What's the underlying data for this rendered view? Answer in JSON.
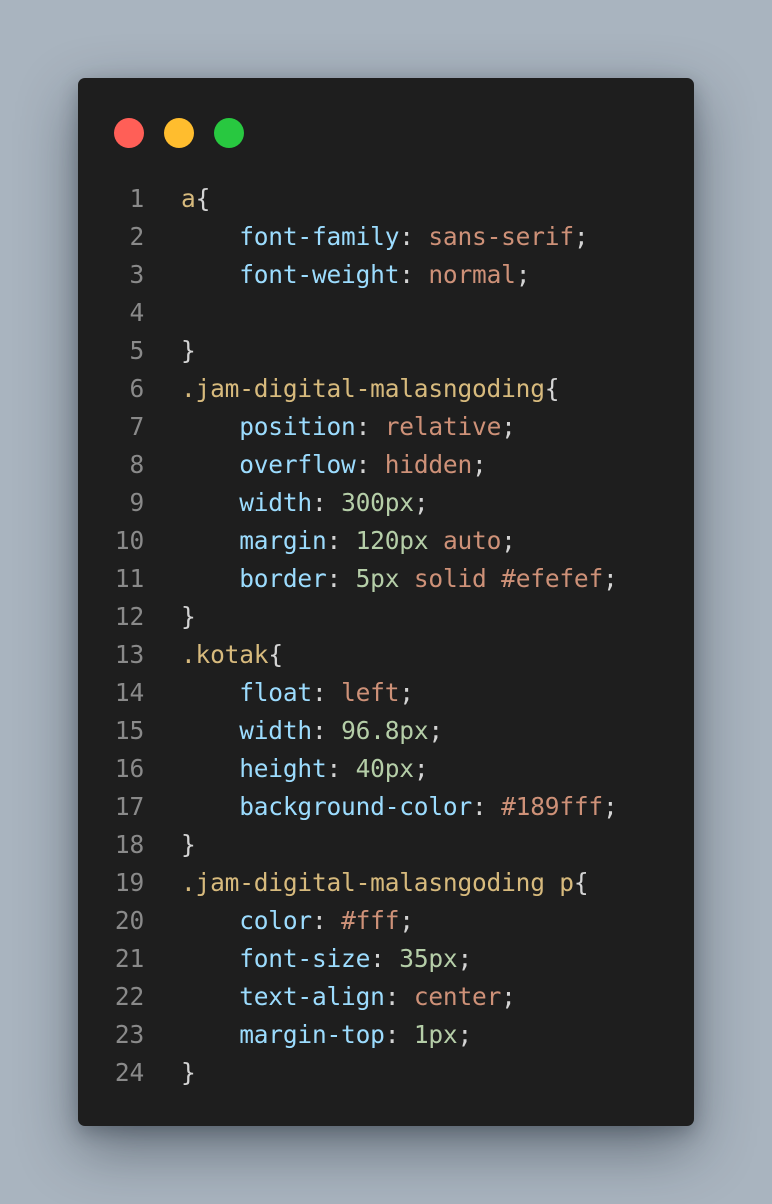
{
  "window": {
    "controls": [
      {
        "name": "close",
        "color": "#ff5f57"
      },
      {
        "name": "minimize",
        "color": "#ffbd2e"
      },
      {
        "name": "maximize",
        "color": "#28c840"
      }
    ]
  },
  "code_lines": [
    {
      "n": "1",
      "tokens": [
        {
          "t": "a",
          "c": "sel"
        },
        {
          "t": "{",
          "c": "punc"
        }
      ]
    },
    {
      "n": "2",
      "tokens": [
        {
          "t": "    ",
          "c": "punc"
        },
        {
          "t": "font-family",
          "c": "prop"
        },
        {
          "t": ": ",
          "c": "punc"
        },
        {
          "t": "sans-serif",
          "c": "val"
        },
        {
          "t": ";",
          "c": "punc"
        }
      ]
    },
    {
      "n": "3",
      "tokens": [
        {
          "t": "    ",
          "c": "punc"
        },
        {
          "t": "font-weight",
          "c": "prop"
        },
        {
          "t": ": ",
          "c": "punc"
        },
        {
          "t": "normal",
          "c": "val"
        },
        {
          "t": ";",
          "c": "punc"
        }
      ]
    },
    {
      "n": "4",
      "tokens": []
    },
    {
      "n": "5",
      "tokens": [
        {
          "t": "}",
          "c": "punc"
        }
      ]
    },
    {
      "n": "6",
      "tokens": [
        {
          "t": ".jam-digital-malasngoding",
          "c": "sel"
        },
        {
          "t": "{",
          "c": "punc"
        }
      ]
    },
    {
      "n": "7",
      "tokens": [
        {
          "t": "    ",
          "c": "punc"
        },
        {
          "t": "position",
          "c": "prop"
        },
        {
          "t": ": ",
          "c": "punc"
        },
        {
          "t": "relative",
          "c": "val"
        },
        {
          "t": ";",
          "c": "punc"
        }
      ]
    },
    {
      "n": "8",
      "tokens": [
        {
          "t": "    ",
          "c": "punc"
        },
        {
          "t": "overflow",
          "c": "prop"
        },
        {
          "t": ": ",
          "c": "punc"
        },
        {
          "t": "hidden",
          "c": "val"
        },
        {
          "t": ";",
          "c": "punc"
        }
      ]
    },
    {
      "n": "9",
      "tokens": [
        {
          "t": "    ",
          "c": "punc"
        },
        {
          "t": "width",
          "c": "prop"
        },
        {
          "t": ": ",
          "c": "punc"
        },
        {
          "t": "300px",
          "c": "num"
        },
        {
          "t": ";",
          "c": "punc"
        }
      ]
    },
    {
      "n": "10",
      "tokens": [
        {
          "t": "    ",
          "c": "punc"
        },
        {
          "t": "margin",
          "c": "prop"
        },
        {
          "t": ": ",
          "c": "punc"
        },
        {
          "t": "120px",
          "c": "num"
        },
        {
          "t": " ",
          "c": "punc"
        },
        {
          "t": "auto",
          "c": "val"
        },
        {
          "t": ";",
          "c": "punc"
        }
      ]
    },
    {
      "n": "11",
      "tokens": [
        {
          "t": "    ",
          "c": "punc"
        },
        {
          "t": "border",
          "c": "prop"
        },
        {
          "t": ": ",
          "c": "punc"
        },
        {
          "t": "5px",
          "c": "num"
        },
        {
          "t": " ",
          "c": "punc"
        },
        {
          "t": "solid",
          "c": "val"
        },
        {
          "t": " ",
          "c": "punc"
        },
        {
          "t": "#efefef",
          "c": "val"
        },
        {
          "t": ";",
          "c": "punc"
        }
      ]
    },
    {
      "n": "12",
      "tokens": [
        {
          "t": "}",
          "c": "punc"
        }
      ]
    },
    {
      "n": "13",
      "tokens": [
        {
          "t": ".kotak",
          "c": "sel"
        },
        {
          "t": "{",
          "c": "punc"
        }
      ]
    },
    {
      "n": "14",
      "tokens": [
        {
          "t": "    ",
          "c": "punc"
        },
        {
          "t": "float",
          "c": "prop"
        },
        {
          "t": ": ",
          "c": "punc"
        },
        {
          "t": "left",
          "c": "val"
        },
        {
          "t": ";",
          "c": "punc"
        }
      ]
    },
    {
      "n": "15",
      "tokens": [
        {
          "t": "    ",
          "c": "punc"
        },
        {
          "t": "width",
          "c": "prop"
        },
        {
          "t": ": ",
          "c": "punc"
        },
        {
          "t": "96.8px",
          "c": "num"
        },
        {
          "t": ";",
          "c": "punc"
        }
      ]
    },
    {
      "n": "16",
      "tokens": [
        {
          "t": "    ",
          "c": "punc"
        },
        {
          "t": "height",
          "c": "prop"
        },
        {
          "t": ": ",
          "c": "punc"
        },
        {
          "t": "40px",
          "c": "num"
        },
        {
          "t": ";",
          "c": "punc"
        }
      ]
    },
    {
      "n": "17",
      "tokens": [
        {
          "t": "    ",
          "c": "punc"
        },
        {
          "t": "background-color",
          "c": "prop"
        },
        {
          "t": ": ",
          "c": "punc"
        },
        {
          "t": "#189fff",
          "c": "val"
        },
        {
          "t": ";",
          "c": "punc"
        }
      ]
    },
    {
      "n": "18",
      "tokens": [
        {
          "t": "}",
          "c": "punc"
        }
      ]
    },
    {
      "n": "19",
      "tokens": [
        {
          "t": ".jam-digital-malasngoding p",
          "c": "sel"
        },
        {
          "t": "{",
          "c": "punc"
        }
      ]
    },
    {
      "n": "20",
      "tokens": [
        {
          "t": "    ",
          "c": "punc"
        },
        {
          "t": "color",
          "c": "prop"
        },
        {
          "t": ": ",
          "c": "punc"
        },
        {
          "t": "#fff",
          "c": "val"
        },
        {
          "t": ";",
          "c": "punc"
        }
      ]
    },
    {
      "n": "21",
      "tokens": [
        {
          "t": "    ",
          "c": "punc"
        },
        {
          "t": "font-size",
          "c": "prop"
        },
        {
          "t": ": ",
          "c": "punc"
        },
        {
          "t": "35px",
          "c": "num"
        },
        {
          "t": ";",
          "c": "punc"
        }
      ]
    },
    {
      "n": "22",
      "tokens": [
        {
          "t": "    ",
          "c": "punc"
        },
        {
          "t": "text-align",
          "c": "prop"
        },
        {
          "t": ": ",
          "c": "punc"
        },
        {
          "t": "center",
          "c": "val"
        },
        {
          "t": ";",
          "c": "punc"
        }
      ]
    },
    {
      "n": "23",
      "tokens": [
        {
          "t": "    ",
          "c": "punc"
        },
        {
          "t": "margin-top",
          "c": "prop"
        },
        {
          "t": ": ",
          "c": "punc"
        },
        {
          "t": "1px",
          "c": "num"
        },
        {
          "t": ";",
          "c": "punc"
        }
      ]
    },
    {
      "n": "24",
      "tokens": [
        {
          "t": "}",
          "c": "punc"
        }
      ]
    }
  ]
}
